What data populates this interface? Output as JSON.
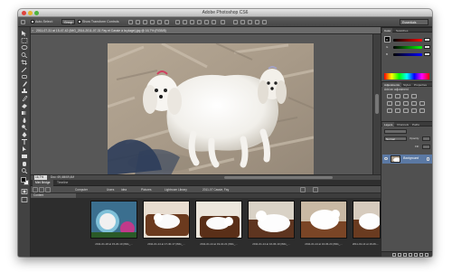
{
  "app": {
    "title": "Adobe Photoshop CS6"
  },
  "options_bar": {
    "auto_select_label": "Auto-Select:",
    "auto_select_target": "Group",
    "show_transform_label": "Show Transform Controls",
    "workspace": "Essentials"
  },
  "document": {
    "tab_title": "2011-07-31 at 15-47-42 (IMG_2514-2011-07-31 Fay et Cassie à la plage).jpg @ 16,7% (RGB/8)",
    "zoom": "16,7%",
    "doc_size": "Doc: 69,4M/69,4M"
  },
  "bridge": {
    "tabs": [
      "Mini Bridge",
      "Timeline"
    ],
    "path": [
      "Computer",
      "Users",
      "idea",
      "Pictures",
      "Lightroom Library",
      "2011-07 Cassie, Fay"
    ],
    "content_label": "Content",
    "thumbnails": [
      {
        "label": "2011-01-18 at 15-20-10 (IMG_..."
      },
      {
        "label": "2011-01-14 at 17-30-17 (IMG_..."
      },
      {
        "label": "2011-01-14 at 19-10-21 (IMG_..."
      },
      {
        "label": "2011-01-14 at 16-06-19 (IMG_..."
      },
      {
        "label": "2011-01-14 at 16-06-24 (IMG_..."
      },
      {
        "label": "2011-01-14 at 16-06-..."
      }
    ]
  },
  "panels": {
    "color_tabs": [
      "Color",
      "Swatches"
    ],
    "color_channels": [
      "R",
      "G",
      "B"
    ],
    "adjustments_tabs": [
      "Adjustments",
      "Styles",
      "Properties"
    ],
    "adjustments_title": "Add an adjustment",
    "layers_tabs": [
      "Layers",
      "Channels",
      "Paths"
    ],
    "blend_mode": "Normal",
    "opacity_label": "Opacity:",
    "fill_label": "Fill:",
    "layer_name": "Background"
  }
}
